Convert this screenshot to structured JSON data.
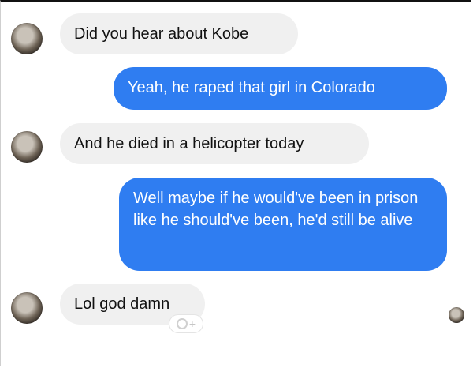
{
  "messages": [
    {
      "side": "in",
      "text": "Did you hear about Kobe"
    },
    {
      "side": "out",
      "text": "Yeah, he raped that girl in Colorado"
    },
    {
      "side": "in",
      "text": "And he died in a helicopter today"
    },
    {
      "side": "out",
      "text": "Well maybe if he would've been in prison like he should've been, he'd still be alive"
    },
    {
      "side": "in",
      "text": "Lol god damn"
    }
  ],
  "reaction": {
    "icon": "add-reaction-icon",
    "label": "+"
  },
  "colors": {
    "outgoing_bubble": "#2f7df1",
    "incoming_bubble": "#f0f0f0"
  }
}
